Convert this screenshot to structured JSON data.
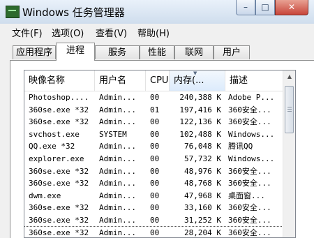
{
  "window": {
    "title": "Windows 任务管理器",
    "min": "–",
    "max": "□",
    "close": "✕"
  },
  "menu": [
    "文件(F)",
    "选项(O)",
    "查看(V)",
    "帮助(H)"
  ],
  "tabs": [
    {
      "label": "应用程序"
    },
    {
      "label": "进程",
      "active": true
    },
    {
      "label": "服务"
    },
    {
      "label": "性能"
    },
    {
      "label": "联网"
    },
    {
      "label": "用户"
    }
  ],
  "table": {
    "columns": [
      "映像名称",
      "用户名",
      "CPU",
      "内存(...",
      "描述"
    ],
    "sorted_column": "内存(...",
    "rows": [
      [
        "Photoshop....",
        "Admin...",
        "00",
        "240,388 K",
        "Adobe P..."
      ],
      [
        "360se.exe *32",
        "Admin...",
        "01",
        "197,416 K",
        "360安全..."
      ],
      [
        "360se.exe *32",
        "Admin...",
        "00",
        "122,136 K",
        "360安全..."
      ],
      [
        "svchost.exe",
        "SYSTEM",
        "00",
        "102,488 K",
        "Windows..."
      ],
      [
        "QQ.exe *32",
        "Admin...",
        "00",
        "76,048 K",
        "腾讯QQ"
      ],
      [
        "explorer.exe",
        "Admin...",
        "00",
        "57,732 K",
        "Windows..."
      ],
      [
        "360se.exe *32",
        "Admin...",
        "00",
        "48,976 K",
        "360安全..."
      ],
      [
        "360se.exe *32",
        "Admin...",
        "00",
        "48,768 K",
        "360安全..."
      ],
      [
        "dwm.exe",
        "Admin...",
        "00",
        "47,968 K",
        "桌面窗..."
      ],
      [
        "360se.exe *32",
        "Admin...",
        "00",
        "33,160 K",
        "360安全..."
      ],
      [
        "360se.exe *32",
        "Admin...",
        "00",
        "31,252 K",
        "360安全..."
      ],
      [
        "360se.exe *32",
        "Admin...",
        "00",
        "28,204 K",
        "360安全..."
      ]
    ]
  },
  "icons": {
    "app": "task-manager-icon",
    "sort": "sort-descending-icon",
    "scroll_up": "scroll-up-arrow-icon"
  }
}
